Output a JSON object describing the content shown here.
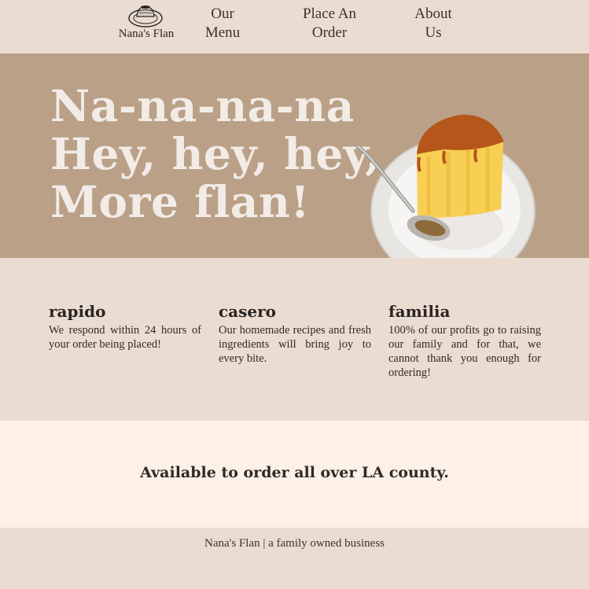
{
  "nav": {
    "brand_name": "Nana's Flan",
    "brand_icon": "flan-plate-logo-icon",
    "links": [
      {
        "line1": "Our",
        "line2": "Menu"
      },
      {
        "line1": "Place An",
        "line2": "Order"
      },
      {
        "line1": "About",
        "line2": "Us"
      }
    ]
  },
  "hero": {
    "line1": "Na-na-na-na",
    "line2": "Hey, hey, hey,",
    "line3": "More flan!",
    "image_icon": "flan-slice-on-plate-icon"
  },
  "features": [
    {
      "title": "rapido",
      "text": "We respond within 24 hours of your order being placed!"
    },
    {
      "title": "casero",
      "text": "Our homemade recipes and fresh ingredients will bring joy to every bite."
    },
    {
      "title": "familia",
      "text": "100% of our profits go to raising our family and for that, we cannot thank you enough for ordering!"
    }
  ],
  "banner": {
    "text": "Available to order all over LA county."
  },
  "footer": {
    "text": "Nana's Flan | a family owned business"
  },
  "colors": {
    "nav_bg": "#ebdcd1",
    "hero_bg": "#b9a087",
    "hero_text": "#f2ebe6",
    "banner_bg": "#fdf0e6",
    "caramel": "#b5561a",
    "custard": "#f2c040"
  }
}
